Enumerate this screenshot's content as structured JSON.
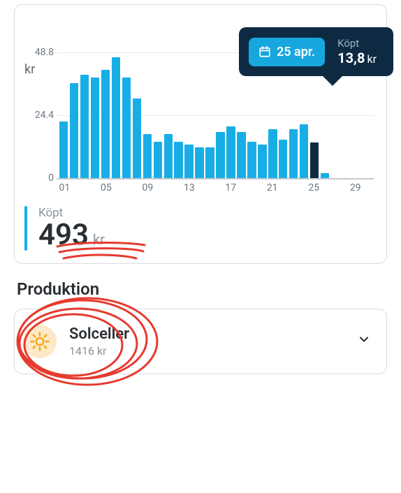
{
  "chart_data": {
    "type": "bar",
    "title": "",
    "xlabel": "",
    "ylabel": "kr",
    "ylim": [
      0,
      48.8
    ],
    "yticks": [
      0,
      24.4,
      48.8
    ],
    "xticks": [
      "01",
      "05",
      "09",
      "13",
      "17",
      "21",
      "25",
      "29"
    ],
    "categories": [
      "01",
      "02",
      "03",
      "04",
      "05",
      "06",
      "07",
      "08",
      "09",
      "10",
      "11",
      "12",
      "13",
      "14",
      "15",
      "16",
      "17",
      "18",
      "19",
      "20",
      "21",
      "22",
      "23",
      "24",
      "25",
      "26",
      "27",
      "28",
      "29",
      "30"
    ],
    "values": [
      22,
      37,
      40,
      39,
      42,
      47,
      39,
      31,
      17,
      14,
      17,
      14,
      13,
      12,
      12,
      18,
      20,
      18,
      14,
      13,
      19,
      15,
      19,
      21,
      13.8,
      2,
      null,
      null,
      null,
      null
    ],
    "highlight_index": 24
  },
  "tooltip": {
    "date": "25 apr.",
    "label": "Köpt",
    "value": "13,8",
    "unit": "kr"
  },
  "total": {
    "label": "Köpt",
    "value": "493",
    "unit": "kr"
  },
  "section": {
    "title": "Produktion"
  },
  "production_card": {
    "title": "Solceller",
    "subtitle": "1416 kr"
  },
  "colors": {
    "bar": "#18aee5",
    "highlight": "#0e2a43",
    "accent": "#18aee5"
  }
}
